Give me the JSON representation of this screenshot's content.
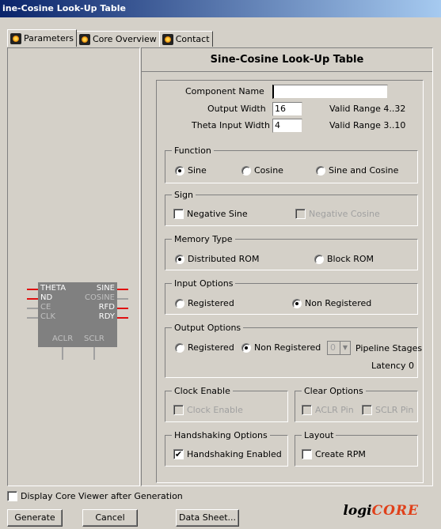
{
  "window": {
    "title": "ine-Cosine Look-Up Table"
  },
  "tabs": [
    {
      "label": "Parameters",
      "icon": "core-icon"
    },
    {
      "label": "Core Overview",
      "icon": "core-icon"
    },
    {
      "label": "Contact",
      "icon": "core-icon"
    }
  ],
  "symbol": {
    "left_pins": [
      "THETA",
      "ND",
      "CE",
      "CLK"
    ],
    "right_pins": [
      "SINE",
      "COSINE",
      "RFD",
      "RDY"
    ],
    "bottom_pins": [
      "ACLR",
      "SCLR"
    ]
  },
  "panel": {
    "title": "Sine-Cosine Look-Up Table",
    "component_name_label": "Component Name",
    "component_name_value": "",
    "output_width_label": "Output Width",
    "output_width_value": "16",
    "output_width_range": "Valid Range 4..32",
    "theta_width_label": "Theta Input Width",
    "theta_width_value": "4",
    "theta_width_range": "Valid Range 3..10",
    "function": {
      "title": "Function",
      "options": [
        "Sine",
        "Cosine",
        "Sine and Cosine"
      ],
      "selected": "Sine"
    },
    "sign": {
      "title": "Sign",
      "negative_sine": "Negative Sine",
      "negative_cosine": "Negative Cosine"
    },
    "memory": {
      "title": "Memory Type",
      "options": [
        "Distributed ROM",
        "Block ROM"
      ],
      "selected": "Distributed ROM"
    },
    "input_options": {
      "title": "Input Options",
      "options": [
        "Registered",
        "Non Registered"
      ],
      "selected": "Non Registered"
    },
    "output_options": {
      "title": "Output Options",
      "options": [
        "Registered",
        "Non Registered"
      ],
      "selected": "Non Registered",
      "pipeline_value": "0",
      "pipeline_label": "Pipeline Stages",
      "latency": "Latency 0"
    },
    "clock_enable": {
      "title": "Clock Enable",
      "label": "Clock Enable"
    },
    "clear_options": {
      "title": "Clear Options",
      "aclr": "ACLR Pin",
      "sclr": "SCLR Pin"
    },
    "handshaking": {
      "title": "Handshaking Options",
      "label": "Handshaking Enabled",
      "checked": true
    },
    "layout": {
      "title": "Layout",
      "label": "Create RPM"
    }
  },
  "footer": {
    "display_viewer": "Display Core Viewer after Generation",
    "generate": "Generate",
    "cancel": "Cancel",
    "datasheet": "Data Sheet...",
    "logo_prefix": "logi",
    "logo_core": "CORE"
  }
}
